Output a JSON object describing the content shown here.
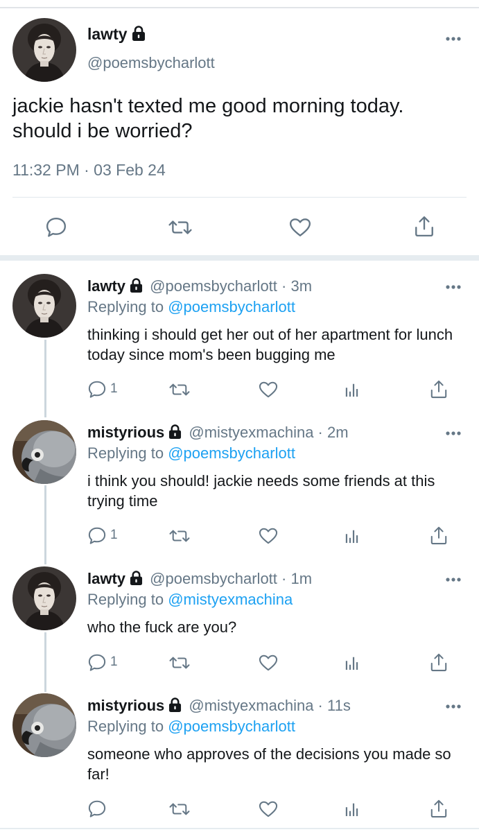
{
  "main_tweet": {
    "name": "lawty",
    "handle": "@poemsbycharlott",
    "text": "jackie hasn't texted me good morning today. should i be worried?",
    "timestamp": "11:32 PM · 03 Feb 24",
    "icons": [
      "reply-icon",
      "retweet-icon",
      "like-icon",
      "share-icon"
    ]
  },
  "replies": [
    {
      "name": "lawty",
      "handle": "@poemsbycharlott · 3m",
      "replying_prefix": "Replying to ",
      "replying_to": "@poemsbycharlott",
      "text": "thinking i should get her out of her apartment for lunch today since mom's been bugging me",
      "reply_count": "1",
      "avatar": "portrait"
    },
    {
      "name": "mistyrious",
      "handle": "@mistyexmachina · 2m",
      "replying_prefix": "Replying to ",
      "replying_to": "@poemsbycharlott",
      "text": "i think you should! jackie needs some friends at this trying time",
      "reply_count": "1",
      "avatar": "parrot"
    },
    {
      "name": "lawty",
      "handle": "@poemsbycharlott · 1m",
      "replying_prefix": "Replying to ",
      "replying_to": "@mistyexmachina",
      "text": "who the fuck are you?",
      "reply_count": "1",
      "avatar": "portrait"
    },
    {
      "name": "mistyrious",
      "handle": "@mistyexmachina · 11s",
      "replying_prefix": "Replying to ",
      "replying_to": "@poemsbycharlott",
      "text": "someone who approves of the decisions you made so far!",
      "reply_count": "",
      "avatar": "parrot"
    }
  ],
  "colors": {
    "link": "#1da1f2",
    "secondary_text": "#657786",
    "icon": "#657786",
    "thread_line": "#ccd6dd"
  }
}
